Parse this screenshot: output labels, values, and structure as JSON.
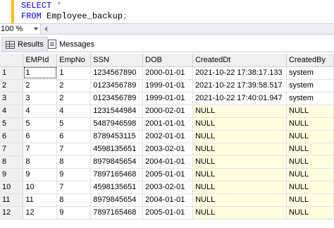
{
  "query": {
    "line1_keyword": "SELECT",
    "line1_star": "*",
    "line2_keyword": "FROM",
    "line2_table": "Employee_backup",
    "line2_terminator": ";"
  },
  "zoom": {
    "value": "100 %"
  },
  "tabs": [
    {
      "label": "Results",
      "icon": "grid-icon"
    },
    {
      "label": "Messages",
      "icon": "messages-icon"
    }
  ],
  "grid": {
    "columns": [
      "EMPId",
      "EmpNo",
      "SSN",
      "DOB",
      "CreatedDt",
      "CreatedBy"
    ],
    "rows": [
      {
        "n": "1",
        "cells": [
          "1",
          "1",
          "1234567890",
          "2000-01-01",
          "2021-10-22 17:38:17.133",
          "system"
        ]
      },
      {
        "n": "2",
        "cells": [
          "2",
          "2",
          "0123456789",
          "1999-01-01",
          "2021-10-22 17:39:58.517",
          "system"
        ]
      },
      {
        "n": "3",
        "cells": [
          "3",
          "2",
          "0123456789",
          "1999-01-01",
          "2021-10-22 17:40:01.947",
          "system"
        ]
      },
      {
        "n": "4",
        "cells": [
          "4",
          "4",
          "1231544984",
          "2000-02-01",
          "NULL",
          "NULL"
        ]
      },
      {
        "n": "5",
        "cells": [
          "5",
          "5",
          "5487946598",
          "2001-01-01",
          "NULL",
          "NULL"
        ]
      },
      {
        "n": "6",
        "cells": [
          "6",
          "6",
          "8789453115",
          "2002-01-01",
          "NULL",
          "NULL"
        ]
      },
      {
        "n": "7",
        "cells": [
          "7",
          "7",
          "4598135651",
          "2003-02-01",
          "NULL",
          "NULL"
        ]
      },
      {
        "n": "8",
        "cells": [
          "8",
          "8",
          "8979845654",
          "2004-01-01",
          "NULL",
          "NULL"
        ]
      },
      {
        "n": "9",
        "cells": [
          "9",
          "9",
          "7897165468",
          "2005-01-01",
          "NULL",
          "NULL"
        ]
      },
      {
        "n": "10",
        "cells": [
          "10",
          "7",
          "4598135651",
          "2003-02-01",
          "NULL",
          "NULL"
        ]
      },
      {
        "n": "11",
        "cells": [
          "11",
          "8",
          "8979845654",
          "2004-01-01",
          "NULL",
          "NULL"
        ]
      },
      {
        "n": "12",
        "cells": [
          "12",
          "9",
          "7897165468",
          "2005-01-01",
          "NULL",
          "NULL"
        ]
      }
    ]
  },
  "colors": {
    "keyword": "#0000ff",
    "null_cell_bg": "#ffffe1",
    "header_bg": "#f0f0f0",
    "margin_marker": "#f5c518"
  }
}
